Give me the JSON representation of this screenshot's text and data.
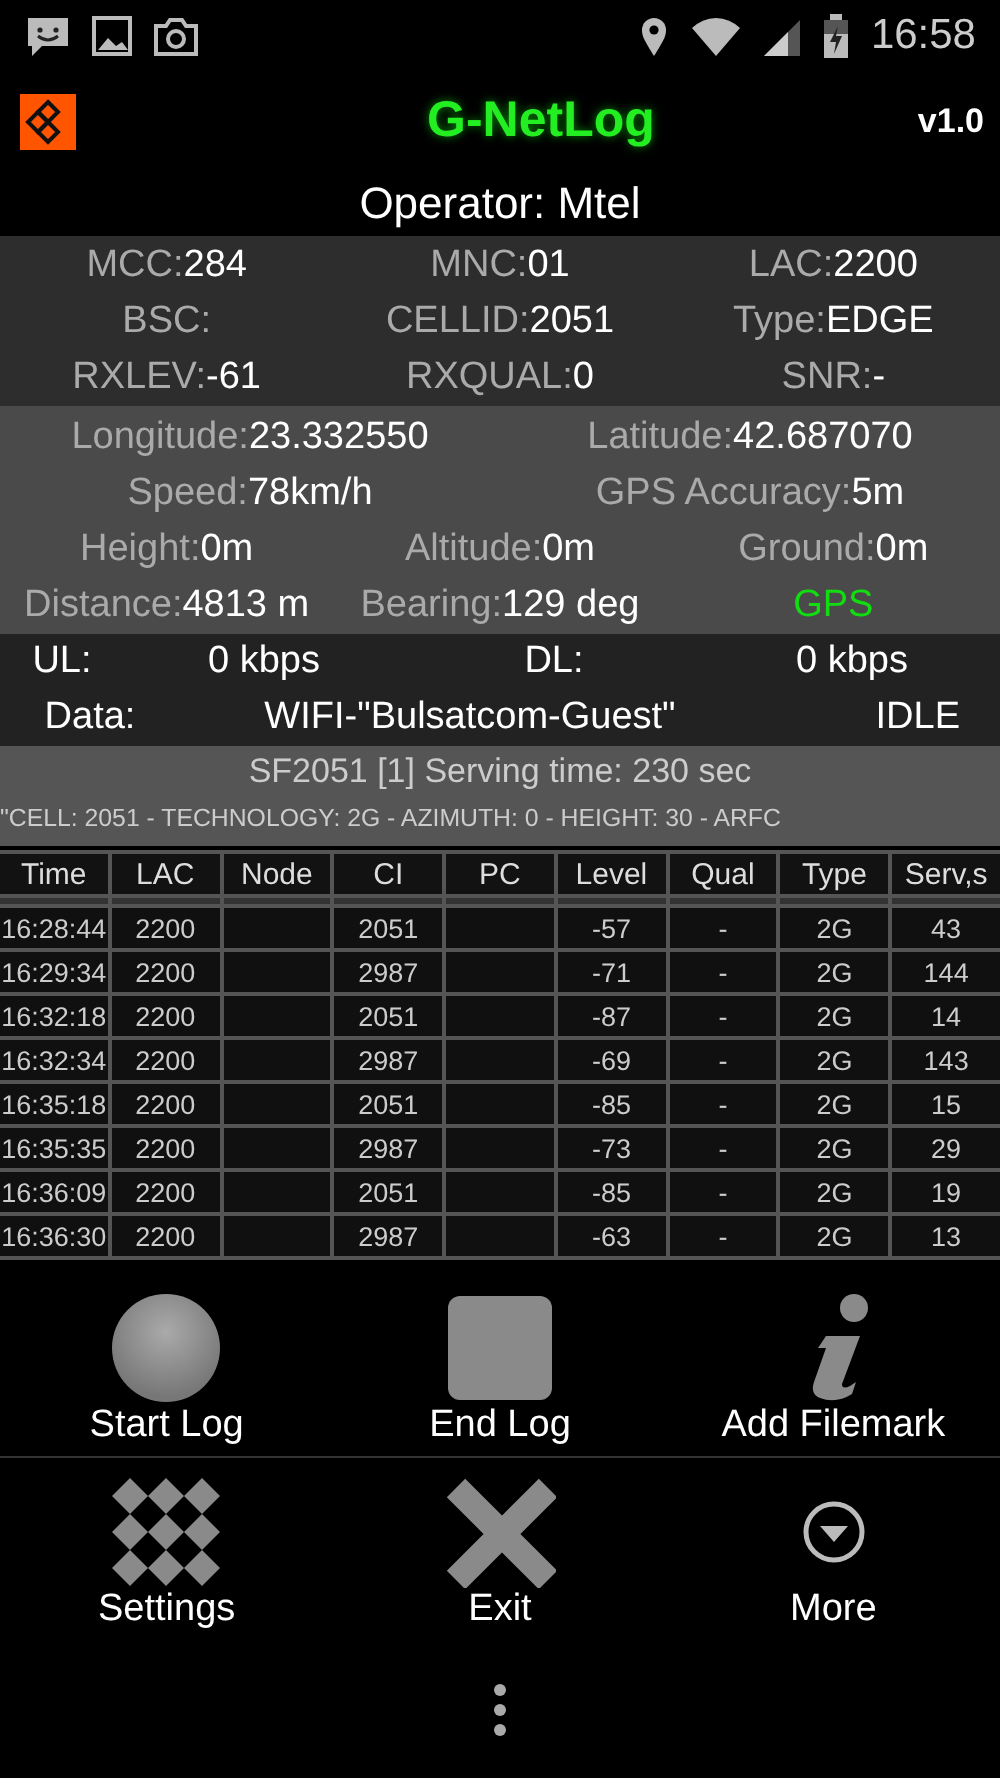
{
  "status_bar": {
    "time": "16:58"
  },
  "app": {
    "title": "G-NetLog",
    "version": "v1.0"
  },
  "operator": "Operator: Mtel",
  "cell_info": [
    [
      {
        "label": "MCC:",
        "value": "284"
      },
      {
        "label": "MNC:",
        "value": "01"
      },
      {
        "label": "LAC:",
        "value": "2200"
      }
    ],
    [
      {
        "label": "BSC:"
      },
      {
        "label": "CELLID:",
        "value": "2051"
      },
      {
        "label": "Type:",
        "value": "EDGE"
      }
    ],
    [
      {
        "label": "RXLEV:",
        "value": "-61"
      },
      {
        "label": "RXQUAL:",
        "value": "0"
      },
      {
        "label": "SNR:",
        "value": "-"
      }
    ]
  ],
  "gps_info": [
    [
      {
        "label": "Longitude:",
        "value": "23.332550"
      },
      {
        "label": "Latitude:",
        "value": "42.687070"
      }
    ],
    [
      {
        "label": "Speed:",
        "value": "78km/h"
      },
      {
        "label": "GPS Accuracy:",
        "value": "5m"
      }
    ],
    [
      {
        "label": "Height:",
        "value": "0m"
      },
      {
        "label": "Altitude:",
        "value": "0m"
      },
      {
        "label": "Ground:",
        "value": "0m"
      }
    ],
    [
      {
        "label": "Distance:",
        "value": "4813 m"
      },
      {
        "label": "Bearing:",
        "value": "129 deg"
      },
      {
        "label": "GPS",
        "color": "#11dd11"
      }
    ]
  ],
  "data_info": [
    [
      "UL:",
      "0 kbps",
      "DL:",
      "0 kbps"
    ],
    [
      "Data:",
      "WIFI-\"Bulsatcom-Guest\"",
      "IDLE"
    ]
  ],
  "serving": {
    "title": "SF2051 [1] Serving time: 230 sec",
    "details": "\"CELL: 2051 - TECHNOLOGY: 2G - AZIMUTH: 0 - HEIGHT: 30 - ARFC"
  },
  "table": {
    "columns": [
      "Time",
      "LAC",
      "Node",
      "CI",
      "PC",
      "Level",
      "Qual",
      "Type",
      "Serv,s"
    ],
    "rows": [
      [
        "16:28:44",
        "2200",
        null,
        "2051",
        null,
        "-57",
        "-",
        "2G",
        "43"
      ],
      [
        "16:29:34",
        "2200",
        null,
        "2987",
        null,
        "-71",
        "-",
        "2G",
        "144"
      ],
      [
        "16:32:18",
        "2200",
        null,
        "2051",
        null,
        "-87",
        "-",
        "2G",
        "14"
      ],
      [
        "16:32:34",
        "2200",
        null,
        "2987",
        null,
        "-69",
        "-",
        "2G",
        "143"
      ],
      [
        "16:35:18",
        "2200",
        null,
        "2051",
        null,
        "-85",
        "-",
        "2G",
        "15"
      ],
      [
        "16:35:35",
        "2200",
        null,
        "2987",
        null,
        "-73",
        "-",
        "2G",
        "29"
      ],
      [
        "16:36:09",
        "2200",
        null,
        "2051",
        null,
        "-85",
        "-",
        "2G",
        "19"
      ],
      [
        "16:36:30",
        "2200",
        null,
        "2987",
        null,
        "-63",
        "-",
        "2G",
        "13"
      ]
    ]
  },
  "menu": {
    "items": [
      {
        "label": "Start Log",
        "kind": "record"
      },
      {
        "label": "End Log",
        "kind": "stop"
      },
      {
        "label": "Add Filemark",
        "kind": "info"
      },
      {
        "label": "Settings",
        "kind": "grid"
      },
      {
        "label": "Exit",
        "kind": "cross"
      },
      {
        "label": "More",
        "kind": "more"
      }
    ]
  }
}
